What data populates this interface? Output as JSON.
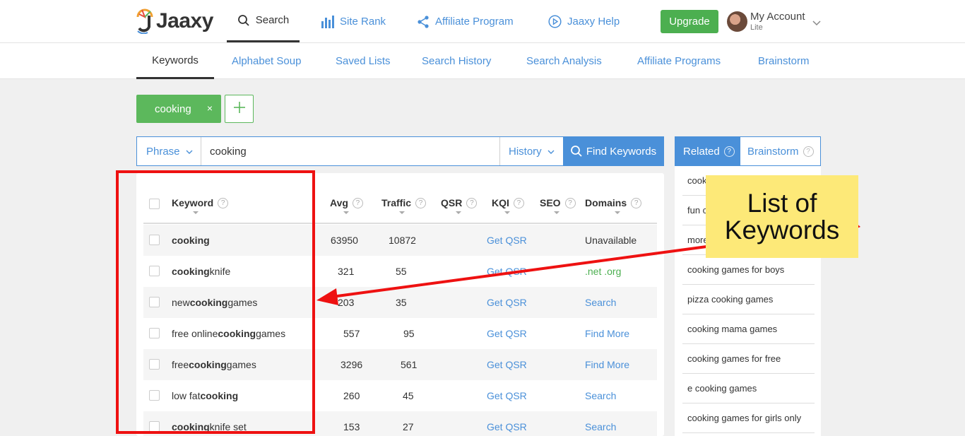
{
  "header": {
    "logo_text": "Jaaxy",
    "nav": [
      {
        "label": "Search",
        "icon": "search-icon"
      },
      {
        "label": "Site Rank",
        "icon": "bar-chart-icon"
      },
      {
        "label": "Affiliate Program",
        "icon": "share-icon"
      },
      {
        "label": "Jaaxy Help",
        "icon": "play-circle-icon"
      }
    ],
    "upgrade_label": "Upgrade",
    "account_name": "My Account",
    "account_tier": "Lite"
  },
  "subnav": [
    "Keywords",
    "Alphabet Soup",
    "Saved Lists",
    "Search History",
    "Search Analysis",
    "Affiliate Programs",
    "Brainstorm"
  ],
  "chip": {
    "label": "cooking",
    "close": "×"
  },
  "search": {
    "mode": "Phrase",
    "value": "cooking",
    "history_label": "History",
    "find_label": "Find Keywords"
  },
  "table": {
    "columns": [
      "Keyword",
      "Avg",
      "Traffic",
      "QSR",
      "KQI",
      "SEO",
      "Domains"
    ],
    "rows": [
      {
        "pre": "",
        "bold": "cooking",
        "post": "",
        "avg": "63950",
        "traffic": "10872",
        "kqi": "Get QSR",
        "domains": "Unavailable",
        "domains_style": "plain"
      },
      {
        "pre": "",
        "bold": "cooking",
        "post": " knife",
        "avg": "321",
        "traffic": "55",
        "kqi": "Get QSR",
        "domains": ".net .org",
        "domains_style": "green"
      },
      {
        "pre": "new ",
        "bold": "cooking",
        "post": " games",
        "avg": "203",
        "traffic": "35",
        "kqi": "Get QSR",
        "domains": "Search",
        "domains_style": "blue"
      },
      {
        "pre": "free online ",
        "bold": "cooking",
        "post": " games",
        "avg": "557",
        "traffic": "95",
        "kqi": "Get QSR",
        "domains": "Find More",
        "domains_style": "blue"
      },
      {
        "pre": "free ",
        "bold": "cooking",
        "post": " games",
        "avg": "3296",
        "traffic": "561",
        "kqi": "Get QSR",
        "domains": "Find More",
        "domains_style": "blue"
      },
      {
        "pre": "low fat ",
        "bold": "cooking",
        "post": "",
        "avg": "260",
        "traffic": "45",
        "kqi": "Get QSR",
        "domains": "Search",
        "domains_style": "blue"
      },
      {
        "pre": "",
        "bold": "cooking",
        "post": " knife set",
        "avg": "153",
        "traffic": "27",
        "kqi": "Get QSR",
        "domains": "Search",
        "domains_style": "blue"
      }
    ]
  },
  "related": {
    "tabs": [
      "Related",
      "Brainstorm"
    ],
    "items": [
      "cook",
      "fun c",
      "more",
      "cooking games for boys",
      "pizza cooking games",
      "cooking mama games",
      "cooking games for free",
      "e cooking games",
      "cooking games for girls only"
    ]
  },
  "annotation": {
    "callout_line1": "List of",
    "callout_line2": "Keywords",
    "box_color": "#ee1111",
    "callout_color": "#fde978"
  },
  "colors": {
    "accent": "#4a90d9",
    "green": "#4caf50",
    "chip": "#5cb85c"
  }
}
